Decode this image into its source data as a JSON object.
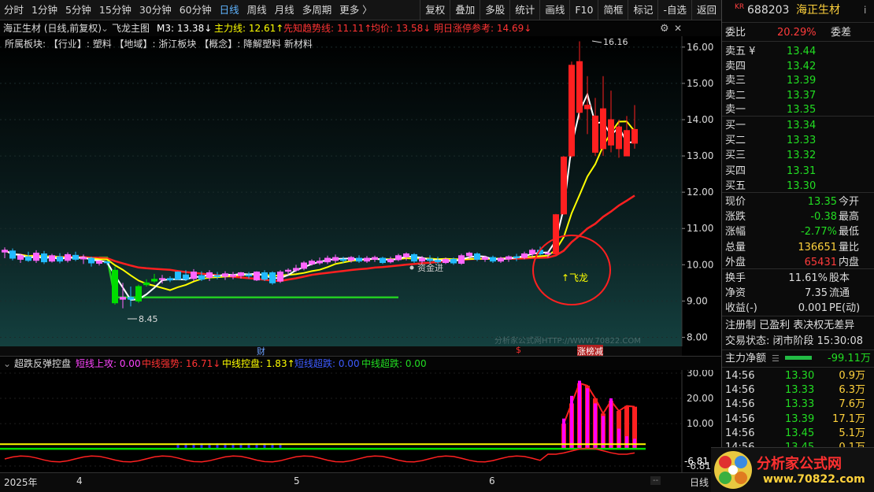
{
  "toolbar": {
    "periods": [
      "分时",
      "1分钟",
      "5分钟",
      "15分钟",
      "30分钟",
      "60分钟",
      "日线",
      "周线",
      "月线",
      "多周期",
      "更多 〉"
    ],
    "active_period": "日线",
    "tools": [
      "复权",
      "叠加",
      "多股",
      "统计",
      "画线",
      "F10",
      "简框",
      "标记",
      "-自选",
      "返回"
    ]
  },
  "main_chart": {
    "stock_label": "海正生材 (日线,前复权)",
    "formula_name": "飞龙主图",
    "m3": "M3: 13.38↓",
    "main_line": "主力线: 12.61↑",
    "trend_line": "先知趋势线: 11.11↑",
    "avg_price": "均价: 13.58↓",
    "limit_ref": "明日涨停参考: 14.69↓",
    "sector_info": "所属板块:   【行业】: 塑料 【地域】: 浙江板块 【概念】: 降解塑料 新材料",
    "high_mark": "16.16",
    "low_mark": "8.45",
    "funds_label": "资金进",
    "flying_dragon_label": "↑飞龙",
    "watermark": "分析家公式网HTTP://WWW.70822.COM",
    "event_markers": [
      "财",
      "$",
      "涨榜减"
    ]
  },
  "indicator": {
    "name": "超跌反弹控盘",
    "short_attack": "短线上攻: 0.00",
    "mid_strong": "中线强势: 16.71↓",
    "mid_control": "中线控盘: 1.83↑",
    "short_oversold": "短线超跌: 0.00",
    "mid_oversold": "中线超跌: 0.00",
    "current_value": "-6.81"
  },
  "time_axis": {
    "year": "2025年",
    "months": [
      "4",
      "5",
      "6"
    ],
    "period_tab": "日线"
  },
  "quote": {
    "code": "688203",
    "name": "海正生材",
    "market_badge": "KR",
    "weibi_label": "委比",
    "weibi_value": "20.29%",
    "weicha_label": "委差",
    "asks": [
      {
        "label": "卖五 ¥",
        "price": "13.44"
      },
      {
        "label": "卖四",
        "price": "13.42"
      },
      {
        "label": "卖三",
        "price": "13.39"
      },
      {
        "label": "卖二",
        "price": "13.37"
      },
      {
        "label": "卖一",
        "price": "13.35"
      }
    ],
    "bids": [
      {
        "label": "买一",
        "price": "13.34"
      },
      {
        "label": "买二",
        "price": "13.33"
      },
      {
        "label": "买三",
        "price": "13.32"
      },
      {
        "label": "买四",
        "price": "13.31"
      },
      {
        "label": "买五",
        "price": "13.30"
      }
    ],
    "stats": [
      {
        "label": "现价",
        "value": "13.35",
        "label2": "今开"
      },
      {
        "label": "涨跌",
        "value": "-0.38",
        "label2": "最高"
      },
      {
        "label": "涨幅",
        "value": "-2.77%",
        "label2": "最低"
      },
      {
        "label": "总量",
        "value": "136651",
        "label2": "量比"
      },
      {
        "label": "外盘",
        "value": "65431",
        "label2": "内盘"
      }
    ],
    "stats2": [
      {
        "label": "换手",
        "value": "11.61%",
        "label2": "股本"
      },
      {
        "label": "净资",
        "value": "7.35",
        "label2": "流通"
      },
      {
        "label": "收益(-)",
        "value": "0.001",
        "label2": "PE(动)"
      }
    ],
    "tags": "注册制 已盈利 表决权无差异",
    "trade_status": "交易状态: 闭市阶段 15:30:08",
    "main_net_label": "主力净额",
    "main_net_value": "-99.11万",
    "ticks": [
      {
        "time": "14:56",
        "price": "13.30",
        "vol": "0.9万"
      },
      {
        "time": "14:56",
        "price": "13.33",
        "vol": "6.3万"
      },
      {
        "time": "14:56",
        "price": "13.33",
        "vol": "7.6万"
      },
      {
        "time": "14:56",
        "price": "13.39",
        "vol": "17.1万"
      },
      {
        "time": "14:56",
        "price": "13.45",
        "vol": "5.1万"
      },
      {
        "time": "14:56",
        "price": "13.45",
        "vol": "0.1万"
      }
    ],
    "logo_text": "分析家公式网",
    "logo_url": "www.70822.com"
  },
  "chart_data": [
    {
      "type": "candlestick",
      "title": "飞龙主图",
      "ylim": [
        7.75,
        16.3
      ],
      "y_ticks": [
        8.0,
        9.0,
        10.0,
        11.0,
        12.0,
        13.0,
        14.0,
        15.0,
        16.0
      ],
      "candles": [
        {
          "o": 10.35,
          "h": 10.48,
          "l": 10.18,
          "c": 10.4
        },
        {
          "o": 10.38,
          "h": 10.45,
          "l": 10.12,
          "c": 10.18
        },
        {
          "o": 10.15,
          "h": 10.3,
          "l": 10.05,
          "c": 10.25
        },
        {
          "o": 10.22,
          "h": 10.36,
          "l": 10.08,
          "c": 10.12
        },
        {
          "o": 10.12,
          "h": 10.4,
          "l": 10.05,
          "c": 10.32
        },
        {
          "o": 10.3,
          "h": 10.38,
          "l": 10.02,
          "c": 10.08
        },
        {
          "o": 10.1,
          "h": 10.3,
          "l": 10.06,
          "c": 10.25
        },
        {
          "o": 10.22,
          "h": 10.32,
          "l": 10.04,
          "c": 10.1
        },
        {
          "o": 10.12,
          "h": 10.34,
          "l": 10.06,
          "c": 10.28
        },
        {
          "o": 10.26,
          "h": 10.36,
          "l": 10.1,
          "c": 10.15
        },
        {
          "o": 10.16,
          "h": 10.28,
          "l": 10.02,
          "c": 10.2
        },
        {
          "o": 10.18,
          "h": 10.22,
          "l": 9.95,
          "c": 10.05
        },
        {
          "o": 10.04,
          "h": 10.12,
          "l": 9.98,
          "c": 10.1
        },
        {
          "o": 10.08,
          "h": 10.1,
          "l": 10.0,
          "c": 10.06
        },
        {
          "o": 9.85,
          "h": 9.95,
          "l": 8.9,
          "c": 8.95
        },
        {
          "o": 9.05,
          "h": 9.5,
          "l": 8.8,
          "c": 9.1
        },
        {
          "o": 9.1,
          "h": 9.4,
          "l": 8.85,
          "c": 9.05
        },
        {
          "o": 9.4,
          "h": 9.45,
          "l": 8.95,
          "c": 9.0
        },
        {
          "o": 9.45,
          "h": 9.6,
          "l": 9.4,
          "c": 9.5
        },
        {
          "o": 9.55,
          "h": 9.75,
          "l": 9.5,
          "c": 9.6
        },
        {
          "o": 9.6,
          "h": 9.72,
          "l": 9.48,
          "c": 9.62
        },
        {
          "o": 9.62,
          "h": 9.68,
          "l": 9.52,
          "c": 9.58
        },
        {
          "o": 9.8,
          "h": 9.82,
          "l": 9.58,
          "c": 9.6
        },
        {
          "o": 9.72,
          "h": 9.85,
          "l": 9.55,
          "c": 9.6
        },
        {
          "o": 9.62,
          "h": 9.88,
          "l": 9.55,
          "c": 9.8
        },
        {
          "o": 9.7,
          "h": 9.82,
          "l": 9.55,
          "c": 9.6
        },
        {
          "o": 9.65,
          "h": 9.85,
          "l": 9.55,
          "c": 9.78
        },
        {
          "o": 9.7,
          "h": 9.8,
          "l": 9.6,
          "c": 9.68
        },
        {
          "o": 9.68,
          "h": 9.82,
          "l": 9.58,
          "c": 9.75
        },
        {
          "o": 9.68,
          "h": 9.8,
          "l": 9.6,
          "c": 9.72
        },
        {
          "o": 9.7,
          "h": 9.8,
          "l": 9.62,
          "c": 9.78
        },
        {
          "o": 9.72,
          "h": 9.8,
          "l": 9.62,
          "c": 9.7
        },
        {
          "o": 9.58,
          "h": 9.82,
          "l": 9.55,
          "c": 9.8
        },
        {
          "o": 9.78,
          "h": 9.85,
          "l": 9.55,
          "c": 9.6
        },
        {
          "o": 9.78,
          "h": 9.82,
          "l": 9.45,
          "c": 9.5
        },
        {
          "o": 9.55,
          "h": 9.85,
          "l": 9.5,
          "c": 9.8
        },
        {
          "o": 9.82,
          "h": 9.9,
          "l": 9.72,
          "c": 9.85
        },
        {
          "o": 9.85,
          "h": 10.0,
          "l": 9.8,
          "c": 9.9
        },
        {
          "o": 9.9,
          "h": 10.1,
          "l": 9.85,
          "c": 10.05
        },
        {
          "o": 10.02,
          "h": 10.15,
          "l": 9.98,
          "c": 10.1
        },
        {
          "o": 10.05,
          "h": 10.2,
          "l": 10.0,
          "c": 10.1
        },
        {
          "o": 10.08,
          "h": 10.25,
          "l": 10.02,
          "c": 10.18
        },
        {
          "o": 10.12,
          "h": 10.28,
          "l": 10.05,
          "c": 10.2
        },
        {
          "o": 10.15,
          "h": 10.22,
          "l": 10.05,
          "c": 10.12
        },
        {
          "o": 10.12,
          "h": 10.24,
          "l": 10.06,
          "c": 10.2
        },
        {
          "o": 10.18,
          "h": 10.26,
          "l": 10.05,
          "c": 10.1
        },
        {
          "o": 10.1,
          "h": 10.24,
          "l": 10.05,
          "c": 10.18
        },
        {
          "o": 10.15,
          "h": 10.25,
          "l": 10.08,
          "c": 10.2
        },
        {
          "o": 10.18,
          "h": 10.22,
          "l": 10.02,
          "c": 10.06
        },
        {
          "o": 10.08,
          "h": 10.22,
          "l": 10.04,
          "c": 10.15
        },
        {
          "o": 10.14,
          "h": 10.3,
          "l": 10.1,
          "c": 10.25
        },
        {
          "o": 10.22,
          "h": 10.34,
          "l": 10.12,
          "c": 10.3
        },
        {
          "o": 10.28,
          "h": 10.32,
          "l": 10.05,
          "c": 10.1
        },
        {
          "o": 10.1,
          "h": 10.24,
          "l": 10.04,
          "c": 10.18
        },
        {
          "o": 10.16,
          "h": 10.26,
          "l": 10.05,
          "c": 10.12
        },
        {
          "o": 10.12,
          "h": 10.22,
          "l": 10.02,
          "c": 10.08
        },
        {
          "o": 10.06,
          "h": 10.2,
          "l": 10.02,
          "c": 10.15
        },
        {
          "o": 10.15,
          "h": 10.2,
          "l": 10.0,
          "c": 10.05
        },
        {
          "o": 10.04,
          "h": 10.3,
          "l": 10.0,
          "c": 10.25
        },
        {
          "o": 10.25,
          "h": 10.36,
          "l": 10.15,
          "c": 10.32
        },
        {
          "o": 10.3,
          "h": 10.34,
          "l": 10.1,
          "c": 10.15
        },
        {
          "o": 10.15,
          "h": 10.25,
          "l": 10.08,
          "c": 10.2
        },
        {
          "o": 10.2,
          "h": 10.25,
          "l": 10.05,
          "c": 10.1
        },
        {
          "o": 10.1,
          "h": 10.22,
          "l": 10.05,
          "c": 10.18
        },
        {
          "o": 10.16,
          "h": 10.26,
          "l": 10.08,
          "c": 10.22
        },
        {
          "o": 10.22,
          "h": 10.3,
          "l": 10.1,
          "c": 10.2
        },
        {
          "o": 10.2,
          "h": 10.36,
          "l": 10.15,
          "c": 10.3
        },
        {
          "o": 10.3,
          "h": 10.45,
          "l": 10.2,
          "c": 10.4
        },
        {
          "o": 10.4,
          "h": 10.5,
          "l": 10.25,
          "c": 10.3
        },
        {
          "o": 10.3,
          "h": 10.38,
          "l": 10.2,
          "c": 10.32
        },
        {
          "o": 10.3,
          "h": 11.4,
          "l": 10.28,
          "c": 11.38
        },
        {
          "o": 11.4,
          "h": 13.0,
          "l": 11.38,
          "c": 12.97
        },
        {
          "o": 13.0,
          "h": 15.6,
          "l": 12.95,
          "c": 15.5
        },
        {
          "o": 15.6,
          "h": 16.16,
          "l": 14.0,
          "c": 14.2
        },
        {
          "o": 14.3,
          "h": 15.2,
          "l": 13.6,
          "c": 14.4
        },
        {
          "o": 14.1,
          "h": 14.6,
          "l": 13.0,
          "c": 13.1
        },
        {
          "o": 13.2,
          "h": 15.2,
          "l": 13.0,
          "c": 14.3
        },
        {
          "o": 14.0,
          "h": 14.8,
          "l": 13.1,
          "c": 13.3
        },
        {
          "o": 13.2,
          "h": 14.0,
          "l": 12.95,
          "c": 13.8
        },
        {
          "o": 13.7,
          "h": 14.1,
          "l": 13.0,
          "c": 13.0
        },
        {
          "o": 13.73,
          "h": 14.4,
          "l": 13.2,
          "c": 13.35
        }
      ],
      "series": [
        {
          "name": "M3",
          "color": "#ffffff"
        },
        {
          "name": "主力线",
          "color": "#ffff00"
        },
        {
          "name": "先知趋势线",
          "color": "#ff2020"
        },
        {
          "name": "绿色趋势线",
          "color": "#22cc22"
        }
      ],
      "annotations": [
        "16.16",
        "8.45",
        "资金进",
        "↑飞龙"
      ]
    },
    {
      "type": "bar",
      "title": "超跌反弹控盘",
      "ylim": [
        -6.81,
        30
      ],
      "y_ticks": [
        10.0,
        20.0,
        30.0,
        -6.81
      ],
      "series": [
        {
          "name": "短线上攻",
          "color": "#ff00ff"
        },
        {
          "name": "中线强势",
          "color": "#ff3030"
        },
        {
          "name": "中线控盘",
          "color": "#ffff00"
        },
        {
          "name": "短线超跌",
          "color": "#2020ff"
        },
        {
          "name": "中线超跌",
          "color": "#00dd00"
        }
      ],
      "pink_bars": [
        0,
        0,
        0,
        0,
        0,
        0,
        0,
        0,
        0,
        0,
        0,
        0,
        0,
        0,
        0,
        0,
        0,
        0,
        0,
        0,
        0,
        0,
        0,
        0,
        0,
        0,
        0,
        0,
        0,
        0,
        0,
        0,
        0,
        0,
        0,
        0,
        0,
        0,
        0,
        0,
        0,
        0,
        0,
        0,
        0,
        0,
        0,
        0,
        0,
        0,
        0,
        0,
        0,
        0,
        0,
        0,
        0,
        0,
        0,
        0,
        0,
        0,
        0,
        0,
        0,
        0,
        0,
        0,
        0,
        0,
        0,
        12,
        21,
        27,
        24,
        18,
        13,
        20,
        8,
        5,
        4
      ],
      "red_bars": [
        0,
        0,
        0,
        0,
        0,
        0,
        0,
        0,
        0,
        0,
        0,
        0,
        0,
        0,
        0,
        0,
        0,
        0,
        0,
        0,
        0,
        0,
        0,
        0,
        0,
        0,
        0,
        0,
        0,
        0,
        0,
        0,
        0,
        0,
        0,
        0,
        0,
        0,
        0,
        0,
        0,
        0,
        0,
        0,
        0,
        0,
        0,
        0,
        0,
        0,
        0,
        0,
        0,
        0,
        0,
        0,
        0,
        0,
        0,
        0,
        0,
        0,
        0,
        0,
        0,
        0,
        0,
        0,
        0,
        0,
        0,
        10,
        18,
        26,
        25,
        20,
        14,
        19,
        15,
        17,
        16.7
      ],
      "blue_bars": [
        0,
        0,
        0,
        0,
        0,
        0,
        0,
        0,
        0,
        0,
        0,
        0,
        0,
        0,
        0,
        0,
        0,
        0,
        0,
        0,
        0,
        0,
        1,
        1,
        1,
        1,
        1,
        1,
        1,
        1,
        1,
        1,
        1,
        1,
        1,
        1,
        0,
        0,
        0,
        0,
        0,
        0,
        0,
        0,
        0,
        0,
        0,
        0,
        0,
        0,
        0,
        0,
        0,
        0,
        0,
        0,
        0,
        0,
        0,
        0,
        0,
        0,
        0,
        0,
        0,
        0,
        0,
        0,
        0,
        0,
        0,
        0,
        0,
        0,
        0,
        0,
        0,
        0,
        0,
        0,
        0
      ],
      "green_line": 0.5,
      "yellow_line": 1.83
    }
  ]
}
